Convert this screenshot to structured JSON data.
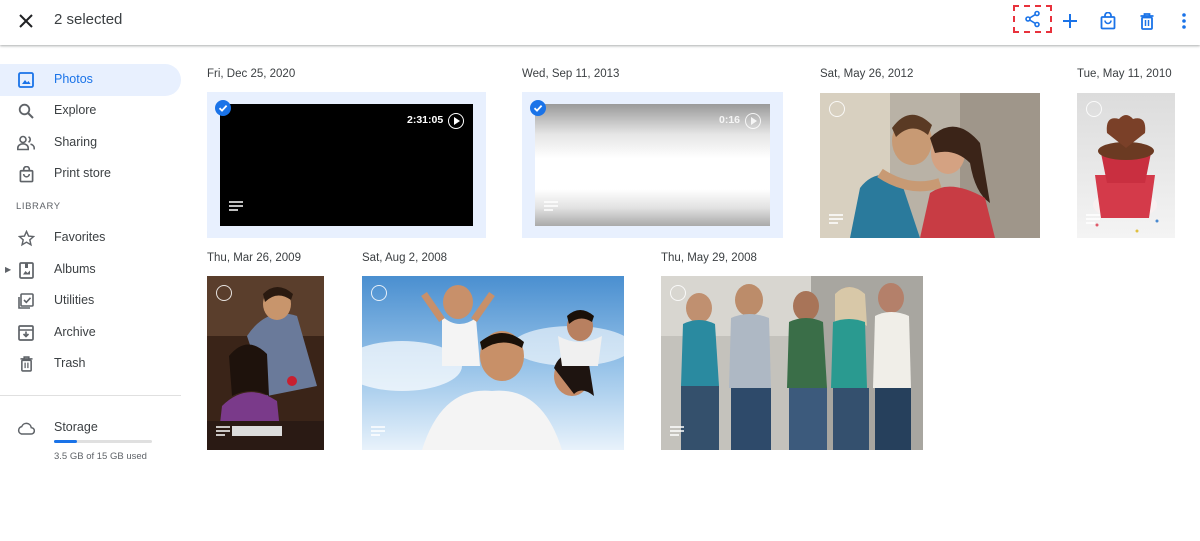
{
  "header": {
    "selected_label": "2 selected",
    "icons": [
      "close-icon",
      "share-icon",
      "add-icon",
      "shopping-bag-icon",
      "trash-icon",
      "more-vert-icon"
    ]
  },
  "sidebar": {
    "items": [
      {
        "label": "Photos",
        "icon": "photos-icon",
        "active": true
      },
      {
        "label": "Explore",
        "icon": "search-icon"
      },
      {
        "label": "Sharing",
        "icon": "people-icon"
      },
      {
        "label": "Print store",
        "icon": "shopping-bag-icon"
      }
    ],
    "library_header": "LIBRARY",
    "library_items": [
      {
        "label": "Favorites",
        "icon": "star-icon"
      },
      {
        "label": "Albums",
        "icon": "album-icon"
      },
      {
        "label": "Utilities",
        "icon": "checkbox-icon"
      },
      {
        "label": "Archive",
        "icon": "archive-icon"
      },
      {
        "label": "Trash",
        "icon": "trash-icon"
      }
    ],
    "storage": {
      "label": "Storage",
      "used_text": "3.5 GB of 15 GB used",
      "fraction": 0.233
    }
  },
  "groups": [
    {
      "date": "Fri, Dec 25, 2020",
      "item": {
        "kind": "video",
        "duration": "2:31:05",
        "selected": true
      }
    },
    {
      "date": "Wed, Sep 11, 2013",
      "item": {
        "kind": "video",
        "duration": "0:16",
        "selected": true
      }
    },
    {
      "date": "Sat, May 26, 2012",
      "item": {
        "kind": "photo",
        "selected": false
      }
    },
    {
      "date": "Tue, May 11, 2010",
      "item": {
        "kind": "photo",
        "selected": false
      }
    },
    {
      "date": "Thu, Mar 26, 2009",
      "item": {
        "kind": "photo",
        "selected": false
      }
    },
    {
      "date": "Sat, Aug 2, 2008",
      "item": {
        "kind": "photo",
        "selected": false
      }
    },
    {
      "date": "Thu, May 29, 2008",
      "item": {
        "kind": "photo",
        "selected": false
      }
    }
  ],
  "colors": {
    "accent": "#1a73e8",
    "selected_bg": "#e8f0fe",
    "highlight_outline": "#e8323c"
  }
}
